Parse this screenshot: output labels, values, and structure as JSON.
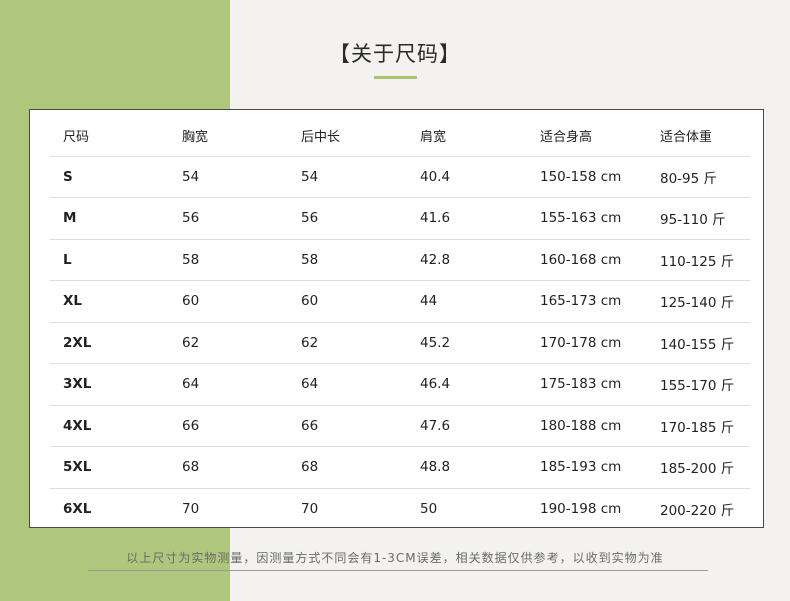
{
  "title": "【关于尺码】",
  "table": {
    "headers": [
      "尺码",
      "胸宽",
      "后中长",
      "肩宽",
      "适合身高",
      "适合体重"
    ],
    "rows": [
      [
        "S",
        "54",
        "54",
        "40.4",
        "150-158 cm",
        "80-95 斤"
      ],
      [
        "M",
        "56",
        "56",
        "41.6",
        "155-163 cm",
        "95-110 斤"
      ],
      [
        "L",
        "58",
        "58",
        "42.8",
        "160-168 cm",
        "110-125 斤"
      ],
      [
        "XL",
        "60",
        "60",
        "44",
        "165-173 cm",
        "125-140 斤"
      ],
      [
        "2XL",
        "62",
        "62",
        "45.2",
        "170-178 cm",
        "140-155 斤"
      ],
      [
        "3XL",
        "64",
        "64",
        "46.4",
        "175-183 cm",
        "155-170 斤"
      ],
      [
        "4XL",
        "66",
        "66",
        "47.6",
        "180-188 cm",
        "170-185 斤"
      ],
      [
        "5XL",
        "68",
        "68",
        "48.8",
        "185-193 cm",
        "185-200 斤"
      ],
      [
        "6XL",
        "70",
        "70",
        "50",
        "190-198 cm",
        "200-220 斤"
      ]
    ]
  },
  "footnote": "以上尺寸为实物测量，因测量方式不同会有1-3CM误差，相关数据仅供参考，以收到实物为准",
  "colors": {
    "accent_green": "#afc77d",
    "background": "#f3f2f0",
    "card": "#ffffff"
  }
}
